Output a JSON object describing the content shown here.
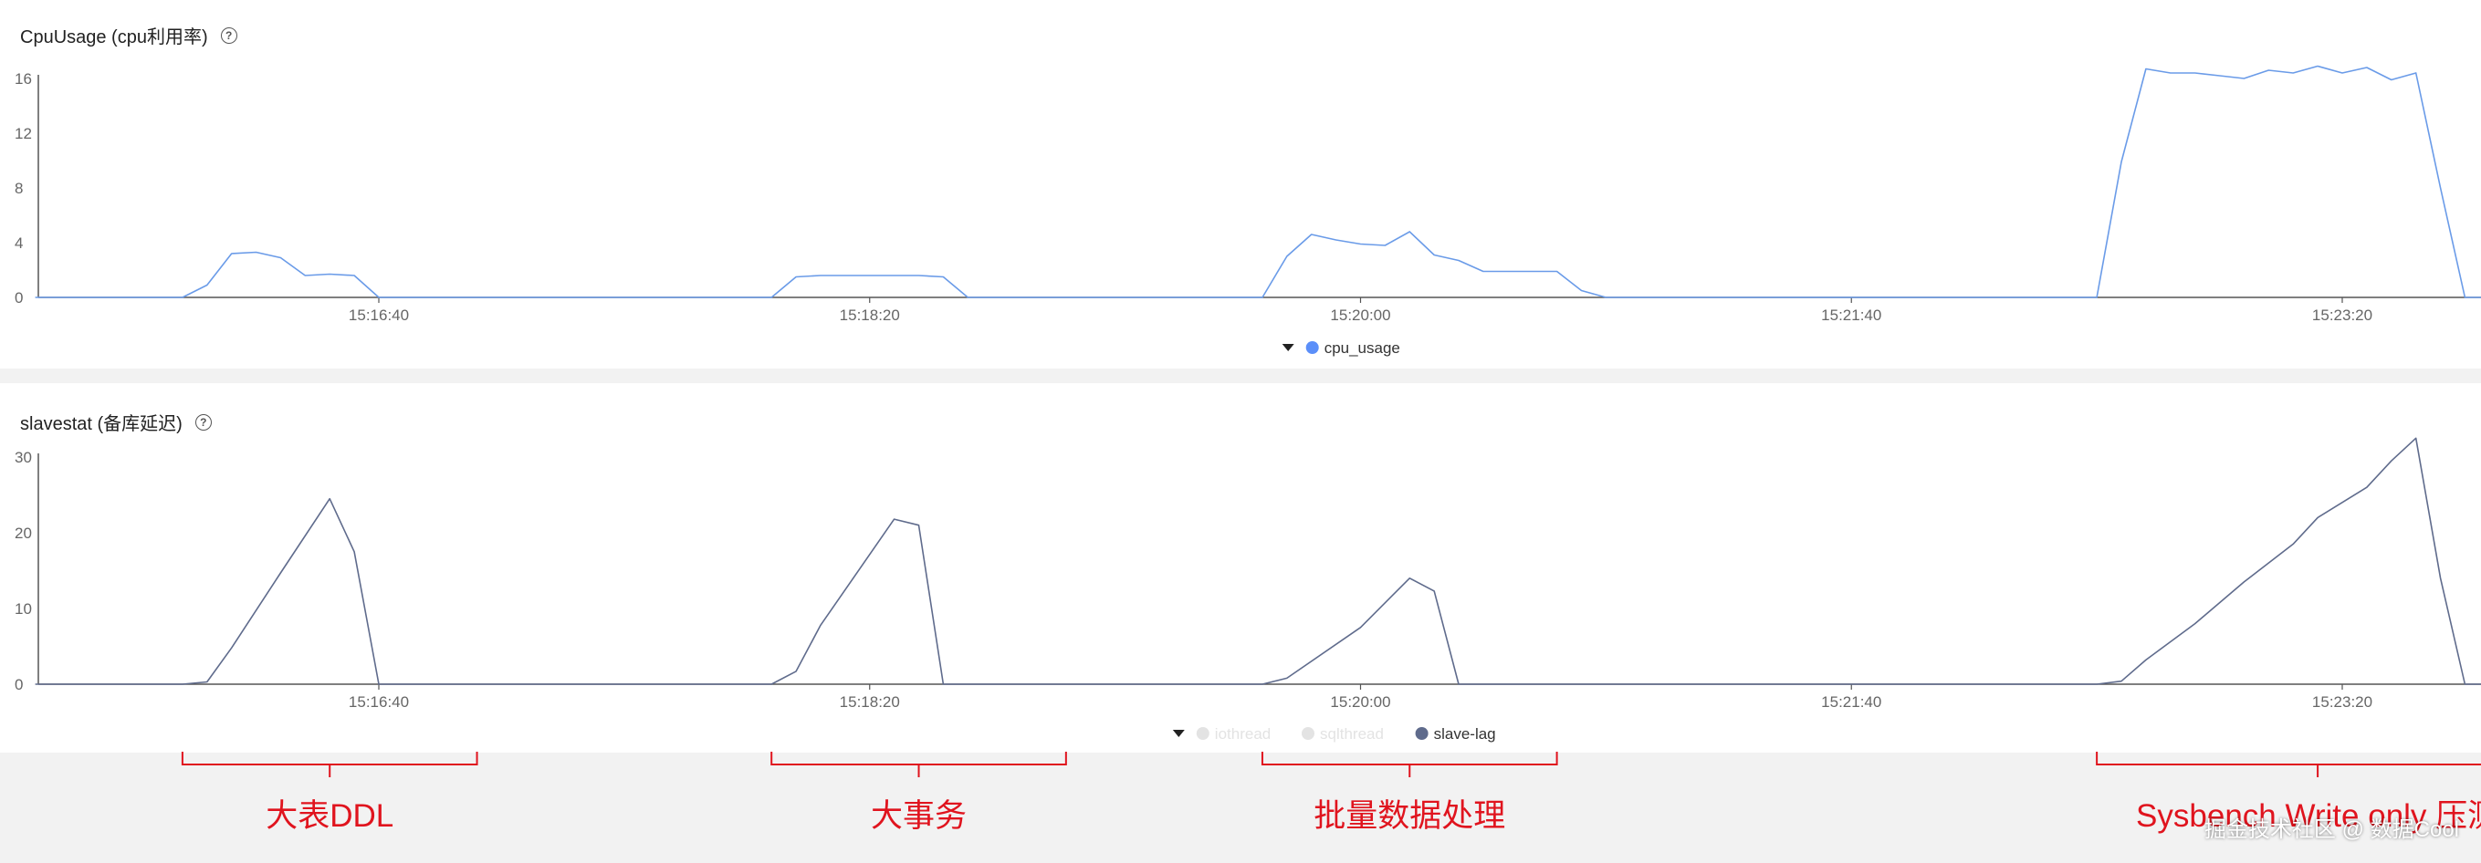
{
  "colors": {
    "cpu_line": "#6a9be8",
    "cpu_legend": "#5b8ff9",
    "slave_line": "#5f6b8c",
    "slave_legend": "#5f6b8c",
    "legend_disabled": "#e3e3e3",
    "annotation": "#e0141e",
    "axis": "#555555",
    "tick_text": "#666666"
  },
  "panels": {
    "cpu": {
      "title": "CpuUsage (cpu利用率)",
      "help_icon": "question-circle-icon"
    },
    "slave": {
      "title": "slavestat (备库延迟)",
      "help_icon": "question-circle-icon"
    }
  },
  "annotations": [
    {
      "label": "大表DDL",
      "from": "15:16:00",
      "to": "15:17:00"
    },
    {
      "label": "大事务",
      "from": "15:18:00",
      "to": "15:19:00"
    },
    {
      "label": "批量数据处理",
      "from": "15:19:40",
      "to": "15:20:40"
    },
    {
      "label": "Sysbench Write only 压测",
      "from": "15:22:30",
      "to": "15:24:00"
    }
  ],
  "watermark": "掘金技术社区 @ 数据Cool",
  "chart_data": [
    {
      "type": "line",
      "x_tick_labels": [
        "15:16:40",
        "15:18:20",
        "15:20:00",
        "15:21:40",
        "15:23:20"
      ],
      "y_tick_labels": [
        "0",
        "4",
        "8",
        "12",
        "16"
      ],
      "ylim": [
        0,
        16
      ],
      "legend": {
        "placement": "bottom-center",
        "entries": [
          {
            "name": "cpu_usage",
            "enabled": true
          }
        ]
      },
      "series": [
        {
          "name": "cpu_usage",
          "points": [
            [
              "15:15:30",
              0
            ],
            [
              "15:15:55",
              0
            ],
            [
              "15:16:00",
              0
            ],
            [
              "15:16:05",
              0.9
            ],
            [
              "15:16:10",
              3.2
            ],
            [
              "15:16:15",
              3.3
            ],
            [
              "15:16:20",
              2.9
            ],
            [
              "15:16:25",
              1.6
            ],
            [
              "15:16:30",
              1.7
            ],
            [
              "15:16:35",
              1.6
            ],
            [
              "15:16:40",
              0
            ],
            [
              "15:17:00",
              0
            ],
            [
              "15:18:00",
              0
            ],
            [
              "15:18:05",
              1.5
            ],
            [
              "15:18:10",
              1.6
            ],
            [
              "15:18:15",
              1.6
            ],
            [
              "15:18:20",
              1.6
            ],
            [
              "15:18:25",
              1.6
            ],
            [
              "15:18:30",
              1.6
            ],
            [
              "15:18:35",
              1.5
            ],
            [
              "15:18:40",
              0
            ],
            [
              "15:19:00",
              0
            ],
            [
              "15:19:40",
              0
            ],
            [
              "15:19:45",
              3.0
            ],
            [
              "15:19:50",
              4.6
            ],
            [
              "15:19:55",
              4.2
            ],
            [
              "15:20:00",
              3.9
            ],
            [
              "15:20:05",
              3.8
            ],
            [
              "15:20:10",
              4.8
            ],
            [
              "15:20:15",
              3.1
            ],
            [
              "15:20:20",
              2.7
            ],
            [
              "15:20:25",
              1.9
            ],
            [
              "15:20:30",
              1.9
            ],
            [
              "15:20:35",
              1.9
            ],
            [
              "15:20:40",
              1.9
            ],
            [
              "15:20:45",
              0.5
            ],
            [
              "15:20:50",
              0
            ],
            [
              "15:21:40",
              0
            ],
            [
              "15:22:00",
              0
            ],
            [
              "15:22:20",
              0
            ],
            [
              "15:22:30",
              0
            ],
            [
              "15:22:35",
              9.9
            ],
            [
              "15:22:40",
              16.7
            ],
            [
              "15:22:45",
              16.4
            ],
            [
              "15:22:50",
              16.4
            ],
            [
              "15:22:55",
              16.2
            ],
            [
              "15:23:00",
              16.0
            ],
            [
              "15:23:05",
              16.6
            ],
            [
              "15:23:10",
              16.4
            ],
            [
              "15:23:15",
              16.9
            ],
            [
              "15:23:20",
              16.4
            ],
            [
              "15:23:25",
              16.8
            ],
            [
              "15:23:30",
              15.9
            ],
            [
              "15:23:35",
              16.4
            ],
            [
              "15:23:40",
              8.0
            ],
            [
              "15:23:45",
              0
            ],
            [
              "15:24:00",
              0
            ]
          ]
        }
      ]
    },
    {
      "type": "line",
      "x_tick_labels": [
        "15:16:40",
        "15:18:20",
        "15:20:00",
        "15:21:40",
        "15:23:20"
      ],
      "y_tick_labels": [
        "0",
        "10",
        "20",
        "30"
      ],
      "ylim": [
        0,
        30
      ],
      "legend": {
        "placement": "bottom-center",
        "entries": [
          {
            "name": "iothread",
            "enabled": false
          },
          {
            "name": "sqlthread",
            "enabled": false
          },
          {
            "name": "slave-lag",
            "enabled": true
          }
        ]
      },
      "series": [
        {
          "name": "slave-lag",
          "points": [
            [
              "15:15:30",
              0
            ],
            [
              "15:16:00",
              0
            ],
            [
              "15:16:05",
              0.3
            ],
            [
              "15:16:10",
              4.8
            ],
            [
              "15:16:20",
              14.7
            ],
            [
              "15:16:30",
              24.5
            ],
            [
              "15:16:35",
              17.5
            ],
            [
              "15:16:40",
              0
            ],
            [
              "15:17:00",
              0
            ],
            [
              "15:18:00",
              0
            ],
            [
              "15:18:05",
              1.7
            ],
            [
              "15:18:10",
              7.8
            ],
            [
              "15:18:25",
              21.8
            ],
            [
              "15:18:30",
              21.0
            ],
            [
              "15:18:35",
              0
            ],
            [
              "15:19:00",
              0
            ],
            [
              "15:19:40",
              0
            ],
            [
              "15:19:45",
              0.8
            ],
            [
              "15:20:00",
              7.5
            ],
            [
              "15:20:10",
              14.0
            ],
            [
              "15:20:15",
              12.3
            ],
            [
              "15:20:20",
              0
            ],
            [
              "15:21:40",
              0
            ],
            [
              "15:22:30",
              0
            ],
            [
              "15:22:35",
              0.4
            ],
            [
              "15:22:40",
              3.2
            ],
            [
              "15:22:50",
              8.0
            ],
            [
              "15:23:00",
              13.5
            ],
            [
              "15:23:10",
              18.5
            ],
            [
              "15:23:15",
              22.0
            ],
            [
              "15:23:25",
              26.0
            ],
            [
              "15:23:30",
              29.5
            ],
            [
              "15:23:35",
              32.5
            ],
            [
              "15:23:40",
              14.0
            ],
            [
              "15:23:45",
              0
            ],
            [
              "15:24:00",
              0
            ]
          ]
        }
      ]
    }
  ]
}
